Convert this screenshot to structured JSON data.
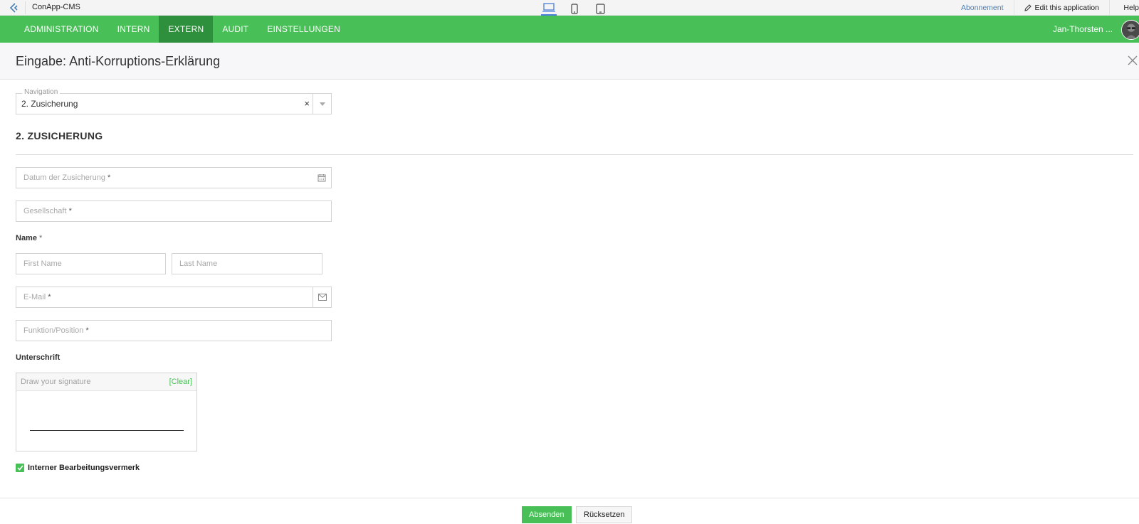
{
  "app": {
    "name": "ConApp-CMS"
  },
  "topbar": {
    "subscription": "Abonnement",
    "edit_app": "Edit this application",
    "help": "Help"
  },
  "nav": {
    "items": [
      {
        "label": "ADMINISTRATION",
        "active": false
      },
      {
        "label": "INTERN",
        "active": false
      },
      {
        "label": "EXTERN",
        "active": true
      },
      {
        "label": "AUDIT",
        "active": false
      },
      {
        "label": "EINSTELLUNGEN",
        "active": false
      }
    ],
    "user_name": "Jan-Thorsten ..."
  },
  "form": {
    "title": "Eingabe: Anti-Korruptions-Erklärung",
    "navigation": {
      "legend": "Navigation",
      "value": "2. Zusicherung",
      "clear": "×"
    },
    "section_title": "2. ZUSICHERUNG",
    "fields": {
      "date": {
        "placeholder": "Datum der Zusicherung",
        "required": "*"
      },
      "company": {
        "placeholder": "Gesellschaft",
        "required": "*"
      },
      "name_label": "Name",
      "name_required": "*",
      "first_name": {
        "placeholder": "First Name"
      },
      "last_name": {
        "placeholder": "Last Name"
      },
      "email": {
        "placeholder": "E-Mail",
        "required": "*"
      },
      "position": {
        "placeholder": "Funktion/Position",
        "required": "*"
      }
    },
    "signature": {
      "label": "Unterschrift",
      "placeholder": "Draw your signature",
      "clear": "[Clear]"
    },
    "internal_note": {
      "label": "Interner Bearbeitungsvermerk",
      "checked": true
    },
    "buttons": {
      "submit": "Absenden",
      "reset": "Rücksetzen"
    }
  },
  "colors": {
    "accent": "#48c057",
    "accent_dark": "#2e8f3c",
    "link": "#4a7fb5"
  }
}
